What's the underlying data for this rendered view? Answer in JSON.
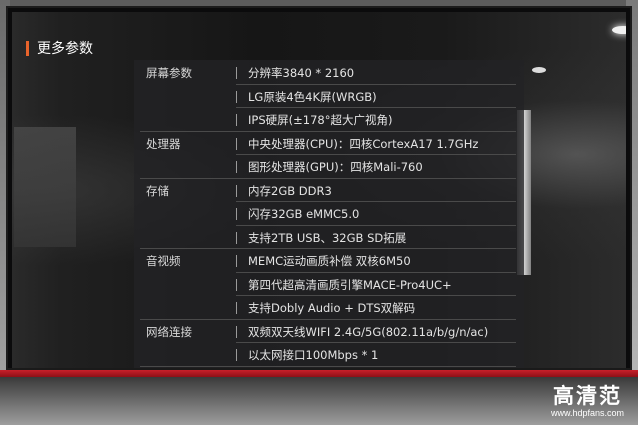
{
  "page": {
    "title": "更多参数"
  },
  "specs": [
    {
      "category": "屏幕参数",
      "value": "分辨率3840 * 2160"
    },
    {
      "category": "",
      "value": "LG原装4色4K屏(WRGB)"
    },
    {
      "category": "",
      "value": "IPS硬屏(±178°超大广视角)"
    },
    {
      "category": "处理器",
      "value": "中央处理器(CPU)：四核CortexA17 1.7GHz"
    },
    {
      "category": "",
      "value": "图形处理器(GPU)：四核Mali-760"
    },
    {
      "category": "存储",
      "value": "内存2GB DDR3"
    },
    {
      "category": "",
      "value": "闪存32GB eMMC5.0"
    },
    {
      "category": "",
      "value": "支持2TB USB、32GB SD拓展"
    },
    {
      "category": "音视频",
      "value": "MEMC运动画质补偿 双核6M50"
    },
    {
      "category": "",
      "value": "第四代超高清画质引擎MACE-Pro4UC+"
    },
    {
      "category": "",
      "value": "支持Dobly Audio + DTS双解码"
    },
    {
      "category": "网络连接",
      "value": "双频双天线WIFI 2.4G/5G(802.11a/b/g/n/ac)"
    },
    {
      "category": "",
      "value": "以太网接口100Mbps * 1"
    }
  ],
  "watermark": {
    "logo": "高清范",
    "url": "www.hdpfans.com"
  },
  "colors": {
    "accent": "#e8632b",
    "tv_bezel_red": "#c8202a"
  }
}
